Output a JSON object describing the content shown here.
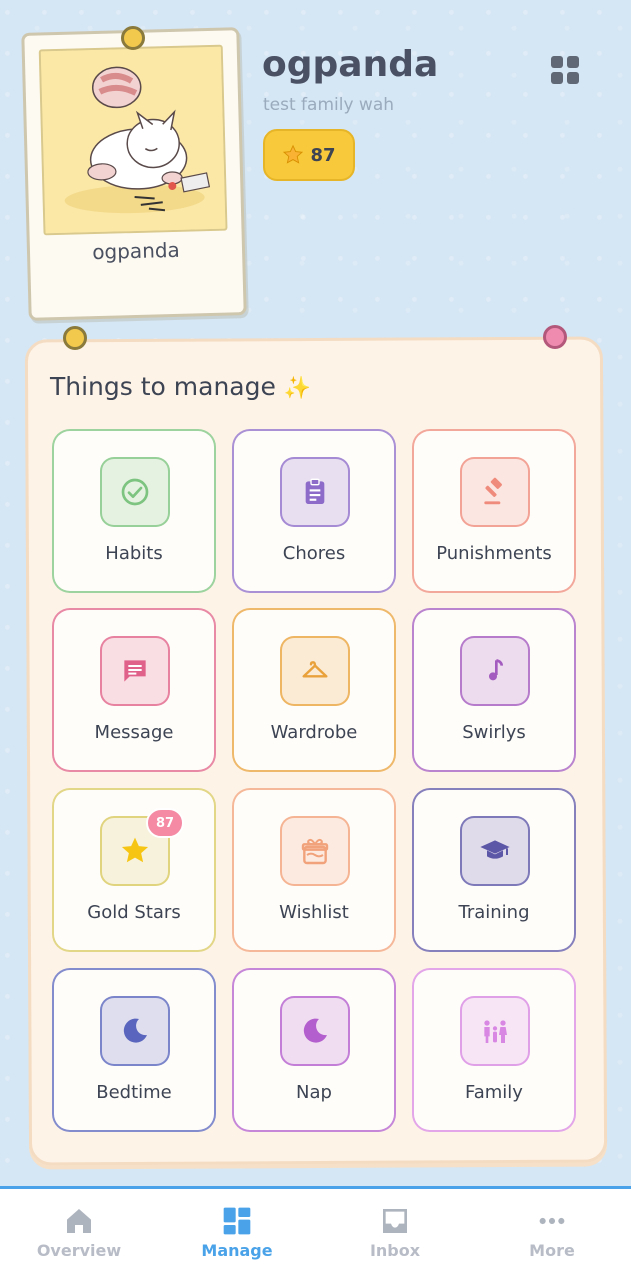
{
  "profile": {
    "name": "ogpanda",
    "polaroid_caption": "ogpanda",
    "family": "test family wah",
    "stars": "87"
  },
  "manage": {
    "title": "Things to manage",
    "tiles": [
      {
        "label": "Habits",
        "icon": "check-circle-icon",
        "color": "#7cc47f"
      },
      {
        "label": "Chores",
        "icon": "clipboard-icon",
        "color": "#8d6cc9"
      },
      {
        "label": "Punishments",
        "icon": "gavel-icon",
        "color": "#ef8b7c"
      },
      {
        "label": "Message",
        "icon": "message-icon",
        "color": "#e0628a"
      },
      {
        "label": "Wardrobe",
        "icon": "hanger-icon",
        "color": "#e9a23b"
      },
      {
        "label": "Swirlys",
        "icon": "music-note-icon",
        "color": "#a35bbf"
      },
      {
        "label": "Gold Stars",
        "icon": "star-icon",
        "color": "#d8c860",
        "badge": "87"
      },
      {
        "label": "Wishlist",
        "icon": "gift-icon",
        "color": "#f1a27a"
      },
      {
        "label": "Training",
        "icon": "graduation-cap-icon",
        "color": "#5d57a8"
      },
      {
        "label": "Bedtime",
        "icon": "moon-icon",
        "color": "#5a66bd"
      },
      {
        "label": "Nap",
        "icon": "moon-icon",
        "color": "#b35fcd"
      },
      {
        "label": "Family",
        "icon": "family-icon",
        "color": "#d888e3"
      }
    ]
  },
  "nav": {
    "items": [
      {
        "label": "Overview",
        "icon": "home-icon"
      },
      {
        "label": "Manage",
        "icon": "grid-icon",
        "active": true
      },
      {
        "label": "Inbox",
        "icon": "inbox-icon"
      },
      {
        "label": "More",
        "icon": "more-icon"
      }
    ]
  },
  "colors": {
    "background": "#d5e6f4",
    "accent": "#4aa3e8",
    "star_badge": "#f8c93a"
  }
}
